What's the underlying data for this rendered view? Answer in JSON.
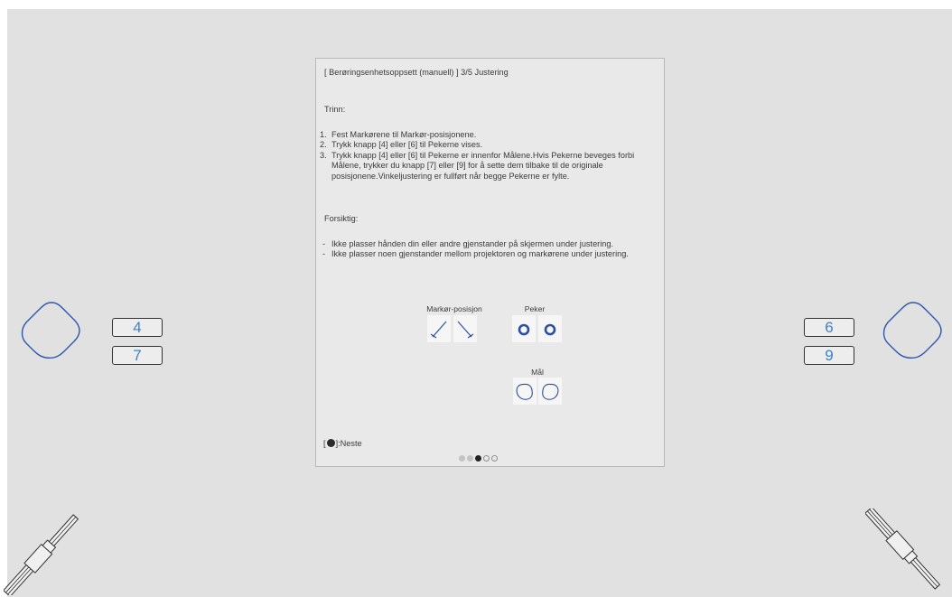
{
  "panel": {
    "title": "[ Berøringsenhetsoppsett (manuell) ]  3/5 Justering",
    "steps_heading": "Trinn:",
    "steps": [
      {
        "num": "1.",
        "text": "Fest Markørene til Markør-posisjonene."
      },
      {
        "num": "2.",
        "text": "Trykk knapp [4] eller [6] til Pekerne vises."
      },
      {
        "num": "3.",
        "text": "Trykk knapp [4] eller [6] til Pekerne er innenfor Målene.Hvis Pekerne beveges forbi Målene, trykker du knapp [7] eller [9] for å sette dem tilbake til de originale posisjonene.Vinkeljustering er fullført når begge Pekerne er fylte."
      }
    ],
    "caution_heading": "Forsiktig:",
    "cautions": [
      {
        "dash": "-",
        "text": "Ikke plasser hånden din eller andre gjenstander på skjermen under justering."
      },
      {
        "dash": "-",
        "text": "Ikke plasser noen gjenstander mellom projektoren og markørene under justering."
      }
    ],
    "diagram": {
      "marker_label": "Markør-posisjon",
      "pointer_label": "Peker",
      "target_label": "Mål"
    },
    "next_hint": {
      "open": "[",
      "close": "]:Neste"
    },
    "progress": {
      "current": 3,
      "total": 5
    }
  },
  "keys": {
    "left_top": "4",
    "left_bottom": "7",
    "right_top": "6",
    "right_bottom": "9"
  },
  "colors": {
    "screen_bg": "#e1e1e1",
    "panel_bg": "#e9e9e9",
    "accent_blue": "#3f82c7",
    "pointer_blue": "#2b4fa3",
    "text": "#3b3b3b"
  },
  "icons": {
    "left_sensor": "rounded-diamond-icon",
    "right_sensor": "rounded-diamond-icon",
    "left_marker": "marker-pen-icon",
    "right_marker": "marker-pen-icon",
    "next_key": "enter-key-icon"
  }
}
